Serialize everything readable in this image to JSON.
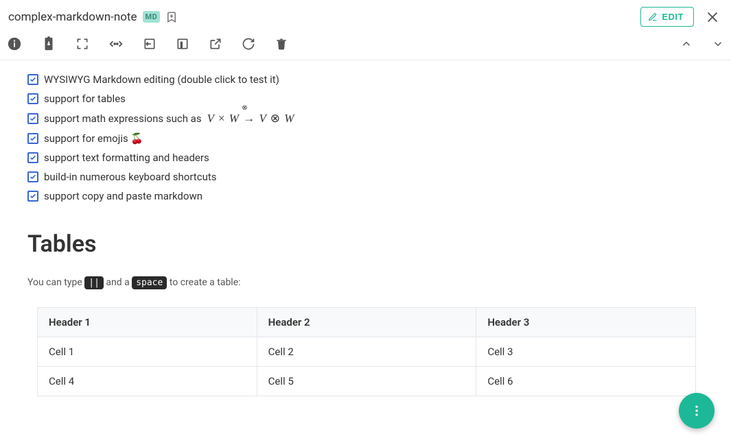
{
  "header": {
    "title": "complex-markdown-note",
    "badge": "MD",
    "edit_label": "EDIT"
  },
  "checklist": [
    "WYSIWYG Markdown editing (double click to test it)",
    "support for tables",
    "support math expressions such as",
    "support for emojis 🍒",
    "support text formatting and headers",
    "build-in numerous keyboard shortcuts",
    "support copy and paste markdown"
  ],
  "math_expression": "V × W → V ⊗ W",
  "section_heading": "Tables",
  "hint": {
    "prefix": "You can type ",
    "kbd1": "||",
    "mid": " and a ",
    "kbd2": "space",
    "suffix": " to create a table:"
  },
  "table": {
    "headers": [
      "Header 1",
      "Header 2",
      "Header 3"
    ],
    "rows": [
      [
        "Cell 1",
        "Cell 2",
        "Cell 3"
      ],
      [
        "Cell 4",
        "Cell 5",
        "Cell 6"
      ]
    ]
  }
}
